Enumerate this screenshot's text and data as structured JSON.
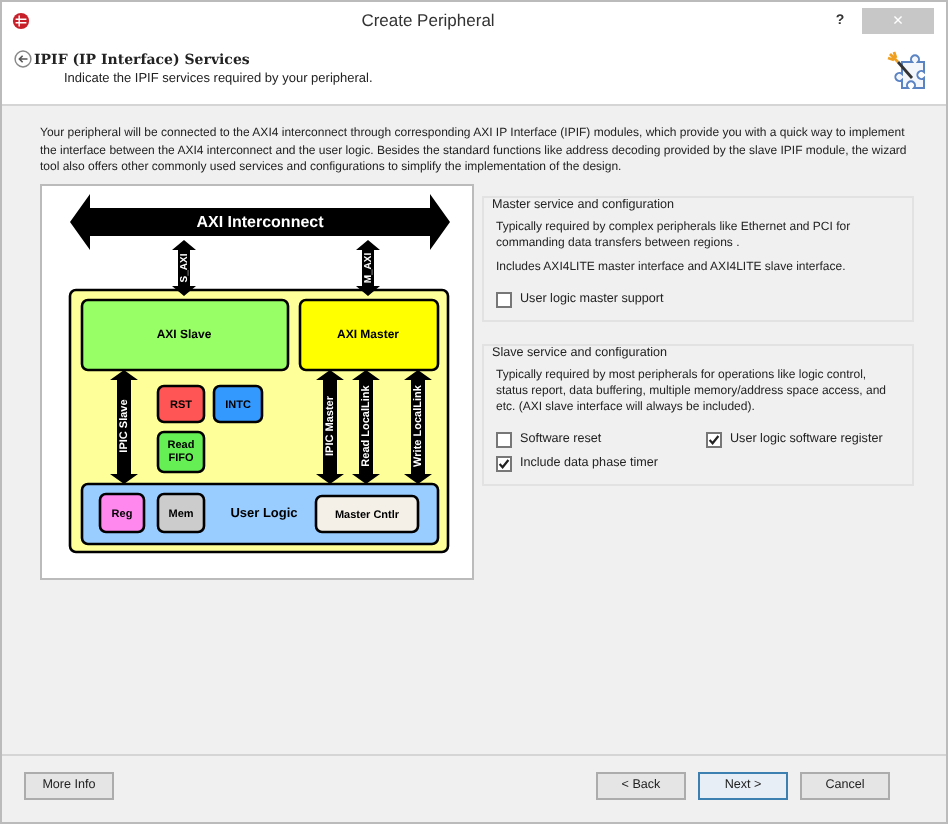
{
  "window": {
    "title": "Create Peripheral",
    "help": "?",
    "close": "×"
  },
  "header": {
    "title": "IPIF (IP Interface) Services",
    "subtitle": "Indicate the IPIF services required by your peripheral."
  },
  "intro": "Your peripheral will be connected to the AXI4 interconnect through corresponding AXI IP Interface (IPIF) modules, which provide you with a quick way to implement the interface between the AXI4 interconnect and the user logic. Besides the standard functions like address decoding provided by the slave IPIF module, the wizard tool also offers other commonly used services and configurations to simplify the implementation of the design.",
  "diagram": {
    "interconnect": "AXI Interconnect",
    "s_axi": "S_AXI",
    "m_axi": "M_AXI",
    "axi_slave": "AXI Slave",
    "axi_master": "AXI Master",
    "ipic_slave": "IPIC Slave",
    "rst": "RST",
    "intc": "INTC",
    "read_fifo": [
      "Read",
      "FIFO"
    ],
    "ipic_master": "IPIC Master",
    "read_locallink": "Read LocalLink",
    "write_locallink": "Write LocalLink",
    "user_logic": "User Logic",
    "reg": "Reg",
    "mem": "Mem",
    "master_cntlr": "Master Cntlr"
  },
  "groups": [
    {
      "title": "Master service and configuration",
      "paragraphs": [
        "Typically required by complex peripherals like Ethernet and PCI for commanding data transfers between regions .",
        "Includes AXI4LITE master interface and AXI4LITE slave interface."
      ],
      "options": [
        {
          "label": "User logic master support",
          "checked": false
        }
      ]
    },
    {
      "title": "Slave service and configuration",
      "paragraphs": [
        "Typically required by most peripherals for operations like logic control, status report, data buffering, multiple memory/address space access, and etc. (AXI slave interface will always be included)."
      ],
      "options": [
        {
          "label": "Software reset",
          "checked": false
        },
        {
          "label": "User logic software register",
          "checked": true
        },
        {
          "label": "Include data phase timer",
          "checked": true
        }
      ]
    }
  ],
  "buttons": {
    "left": [
      {
        "label": "More Info",
        "default": false
      }
    ],
    "right": [
      {
        "label": "< Back",
        "default": false
      },
      {
        "label": "Next >",
        "default": true
      },
      {
        "label": "Cancel",
        "default": false
      }
    ]
  }
}
